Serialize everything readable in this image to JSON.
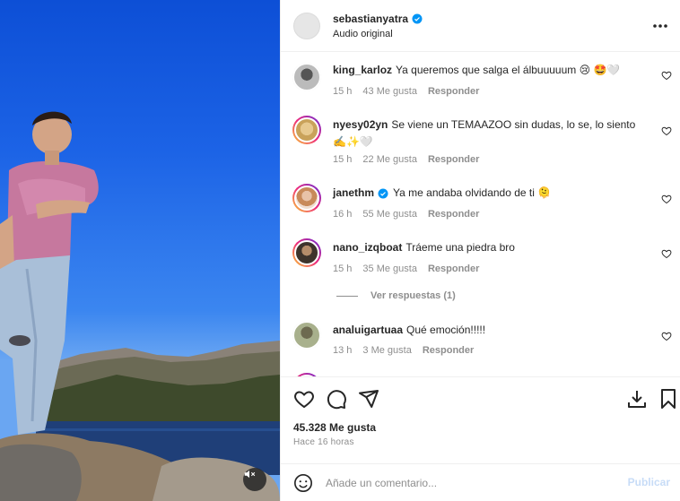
{
  "header": {
    "username": "sebastianyatra",
    "subtitle": "Audio original"
  },
  "comments": [
    {
      "user": "king_karloz",
      "text": "Ya queremos que salga el álbuuuuum 😢 🤩🤍",
      "time": "15 h",
      "likes": "43 Me gusta",
      "reply": "Responder"
    },
    {
      "user": "nyesy02yn",
      "text": "Se viene un TEMAAZOO sin dudas, lo se, lo siento ✍️✨🤍",
      "time": "15 h",
      "likes": "22 Me gusta",
      "reply": "Responder"
    },
    {
      "user": "janethm",
      "text": "Ya me andaba olvidando de ti 🫠",
      "time": "16 h",
      "likes": "55 Me gusta",
      "reply": "Responder"
    },
    {
      "user": "nano_izqboat",
      "text": "Tráeme una piedra bro",
      "time": "15 h",
      "likes": "35 Me gusta",
      "reply": "Responder"
    },
    {
      "user": "analuigartuaa",
      "text": "Qué emoción!!!!!",
      "time": "13 h",
      "likes": "3 Me gusta",
      "reply": "Responder"
    }
  ],
  "view_replies": "Ver respuestas (1)",
  "likes_total": "45.328 Me gusta",
  "time_ago": "Hace 16 horas",
  "add_comment": {
    "placeholder": "Añade un comentario...",
    "publish": "Publicar"
  },
  "icons": {
    "verified": "verified-badge-icon",
    "more": "more-options-icon",
    "heart": "heart-icon",
    "comment": "comment-icon",
    "share": "share-icon",
    "save": "bookmark-icon",
    "download": "download-icon",
    "emoji": "emoji-icon",
    "mute": "mute-icon"
  },
  "colors": {
    "verified": "#0095f6",
    "publish_disabled": "#c7dcf7",
    "meta_gray": "#8e8e8e"
  }
}
